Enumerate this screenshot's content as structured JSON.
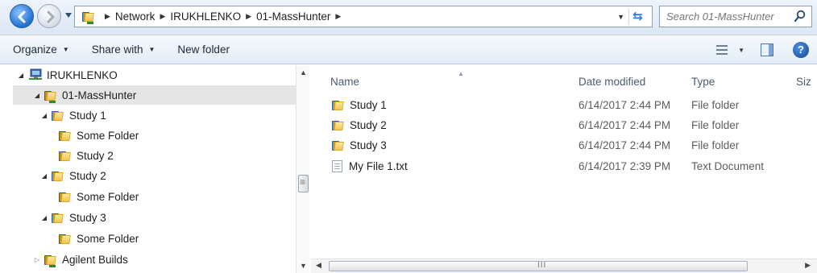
{
  "address_bar": {
    "crumbs": [
      "Network",
      "IRUKHLENKO",
      "01-MassHunter"
    ],
    "search_placeholder": "Search 01-MassHunter"
  },
  "toolbar": {
    "organize": "Organize",
    "share_with": "Share with",
    "new_folder": "New folder"
  },
  "nav_tree": [
    {
      "label": "IRUKHLENKO",
      "icon": "network-computer-icon",
      "expanded": true
    },
    {
      "label": "01-MassHunter",
      "icon": "network-folder-icon",
      "expanded": true,
      "selected": true
    },
    {
      "label": "Study 1",
      "icon": "folder-icon",
      "expanded": true
    },
    {
      "label": "Some Folder",
      "icon": "folder-icon"
    },
    {
      "label": "Study 2",
      "icon": "folder-icon"
    },
    {
      "label": "Study 2",
      "icon": "folder-icon",
      "expanded": true
    },
    {
      "label": "Some Folder",
      "icon": "folder-icon"
    },
    {
      "label": "Study 3",
      "icon": "folder-icon",
      "expanded": true
    },
    {
      "label": "Some Folder",
      "icon": "folder-icon"
    },
    {
      "label": "Agilent Builds",
      "icon": "network-folder-icon",
      "expanded": false
    }
  ],
  "columns": {
    "name": "Name",
    "date": "Date modified",
    "type": "Type",
    "size": "Siz"
  },
  "files": [
    {
      "name": "Study 1",
      "date": "6/14/2017 2:44 PM",
      "type": "File folder",
      "icon": "folder-icon"
    },
    {
      "name": "Study 2",
      "date": "6/14/2017 2:44 PM",
      "type": "File folder",
      "icon": "folder-icon"
    },
    {
      "name": "Study 3",
      "date": "6/14/2017 2:44 PM",
      "type": "File folder",
      "icon": "folder-icon"
    },
    {
      "name": "My File 1.txt",
      "date": "6/14/2017 2:39 PM",
      "type": "Text Document",
      "icon": "text-file-icon"
    }
  ],
  "scroll": {
    "grip": "III"
  }
}
